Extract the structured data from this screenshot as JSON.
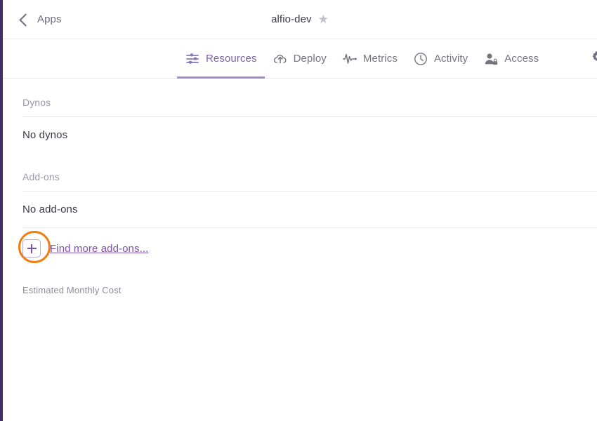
{
  "topbar": {
    "back_label": "Apps",
    "back_icon": "chevron-left-icon",
    "app_name": "alfio-dev",
    "favorite_icon": "star-icon"
  },
  "tabs": [
    {
      "label": "Resources",
      "icon": "sliders-icon",
      "active": true
    },
    {
      "label": "Deploy",
      "icon": "cloud-upload-icon",
      "active": false
    },
    {
      "label": "Metrics",
      "icon": "pulse-icon",
      "active": false
    },
    {
      "label": "Activity",
      "icon": "clock-icon",
      "active": false
    },
    {
      "label": "Access",
      "icon": "user-lock-icon",
      "active": false
    }
  ],
  "settings_icon": "gear-icon",
  "sections": [
    {
      "heading": "Dynos",
      "value": "No dynos"
    },
    {
      "heading": "Add-ons",
      "value": "No add-ons"
    }
  ],
  "addon_action": {
    "add_button_icon": "plus-icon",
    "link_label": "Find more add-ons..."
  },
  "estimated_cost_label": "Estimated Monthly Cost",
  "colors": {
    "accent_purple": "#7d52b0",
    "tab_active": "#7d62ab",
    "tab_underline": "#a08ec4",
    "left_rail": "#452f62",
    "annotation_orange": "#f07d10",
    "muted_text": "#9b99a6",
    "body_text": "#3b3b46"
  }
}
